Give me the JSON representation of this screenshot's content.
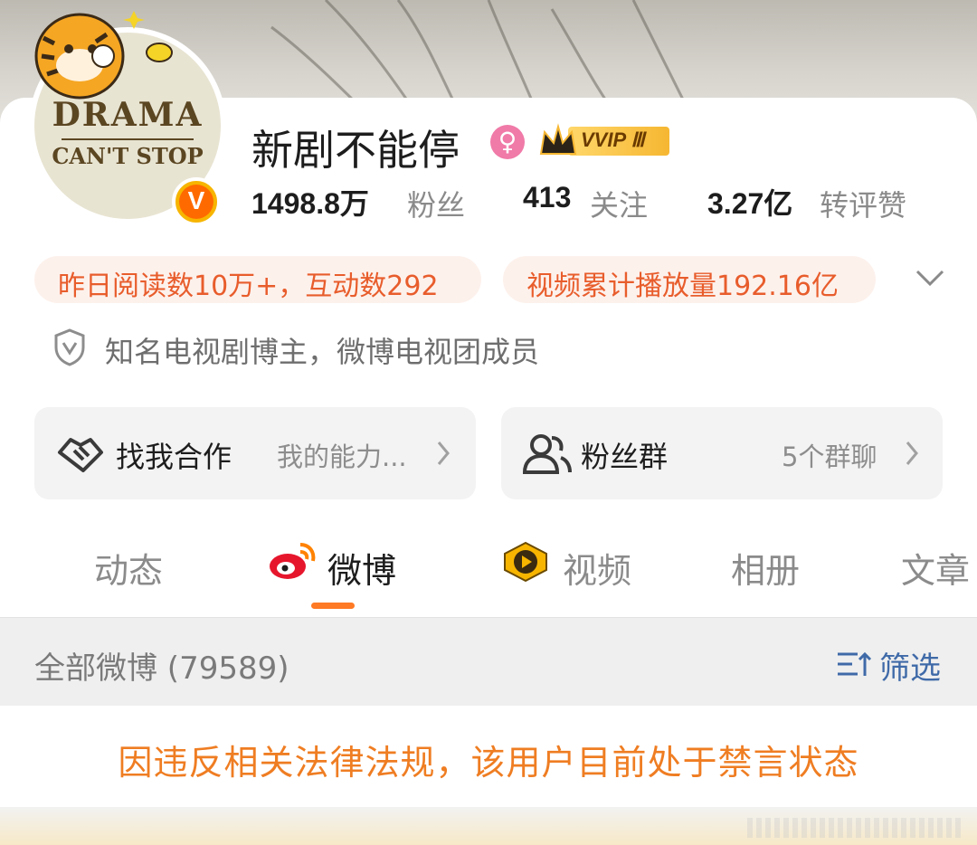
{
  "profile": {
    "avatar_line1": "DRAMA",
    "avatar_line2": "CAN'T STOP",
    "verified_badge": "V",
    "name": "新剧不能停",
    "gender_symbol": "♀",
    "vip_label": "VVIP Ⅲ",
    "stats": {
      "fans_num": "1498.8万",
      "fans_label": "粉丝",
      "follow_num": "413",
      "follow_label": "关注",
      "likes_num": "3.27亿",
      "likes_label": "转评赞"
    },
    "pills": {
      "read_stats": "昨日阅读数10万+，互动数292",
      "video_stats": "视频累计播放量192.16亿"
    },
    "certification": "知名电视剧博主，微博电视团成员"
  },
  "actions": {
    "cooperate_label": "找我合作",
    "cooperate_sub": "我的能力...",
    "fan_group_label": "粉丝群",
    "fan_group_sub": "5个群聊"
  },
  "tabs": {
    "dynamic": "动态",
    "weibo": "微博",
    "video": "视频",
    "album": "相册",
    "article": "文章"
  },
  "feed": {
    "all_label": "全部微博 (79589)",
    "filter_label": "筛选"
  },
  "notice": "因违反相关法律法规，该用户目前处于禁言状态",
  "colors": {
    "accent": "#ff7a24",
    "pill_text": "#e85d2c",
    "notice_text": "#ef7d22",
    "filter_text": "#3f6aa8"
  }
}
